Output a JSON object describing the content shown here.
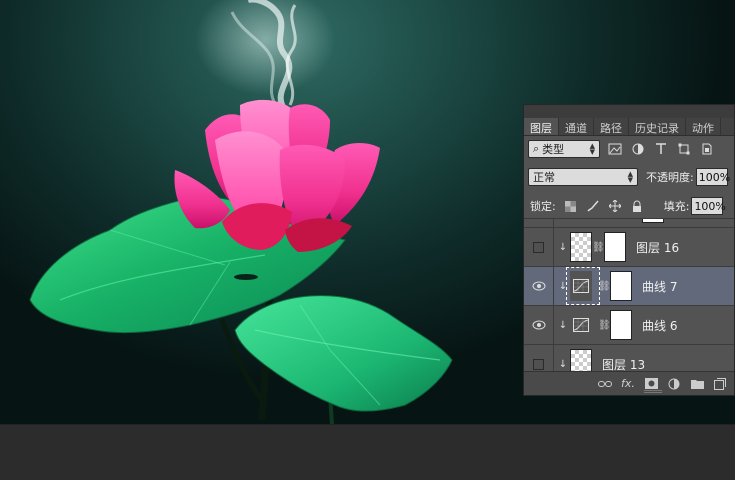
{
  "panel": {
    "tabs": [
      "图层",
      "通道",
      "路径",
      "历史记录",
      "动作"
    ],
    "active_tab": 0,
    "filter": {
      "search_glyph": "⌕",
      "label": "类型"
    },
    "blend_mode": "正常",
    "opacity_label": "不透明度:",
    "opacity_value": "100%",
    "lock_label": "锁定:",
    "fill_label": "填充:",
    "fill_value": "100%",
    "layers": [
      {
        "name": "图层 16",
        "visible": false,
        "type": "pixel"
      },
      {
        "name": "曲线 7",
        "visible": true,
        "type": "curves",
        "selected": true
      },
      {
        "name": "曲线 6",
        "visible": true,
        "type": "curves"
      },
      {
        "name": "图层 13",
        "visible": false,
        "type": "pixel"
      }
    ]
  },
  "colors": {
    "panel_bg": "#535353",
    "selected_row": "#61697a",
    "lotus_pink": "#ff3fa0",
    "leaf_green": "#1fc070"
  },
  "icons": [
    "search-icon",
    "image-filter-icon",
    "adjust-filter-icon",
    "text-filter-icon",
    "shape-filter-icon",
    "smart-filter-icon",
    "lock-transparent-icon",
    "lock-brush-icon",
    "lock-move-icon",
    "lock-all-icon",
    "link-icon",
    "fx-icon",
    "mask-icon",
    "adjustment-icon",
    "folder-icon",
    "new-layer-icon",
    "trash-icon"
  ]
}
